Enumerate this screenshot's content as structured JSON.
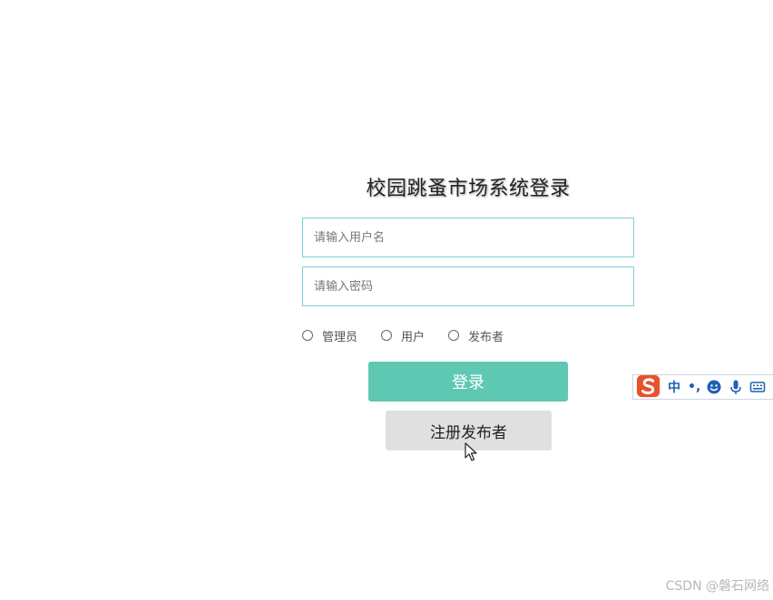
{
  "login": {
    "title": "校园跳蚤市场系统登录",
    "username_placeholder": "请输入用户名",
    "password_placeholder": "请输入密码",
    "roles": [
      "管理员",
      "用户",
      "发布者"
    ],
    "login_label": "登录",
    "register_label": "注册发布者"
  },
  "ime": {
    "mode_label": "中",
    "punct_label": "•,"
  },
  "watermark": "CSDN @磐石网络",
  "colors": {
    "accent": "#5ec8b2",
    "input_border": "#7ccfd6",
    "secondary_button": "#e0e0e0",
    "ime_brand": "#e8512a"
  }
}
